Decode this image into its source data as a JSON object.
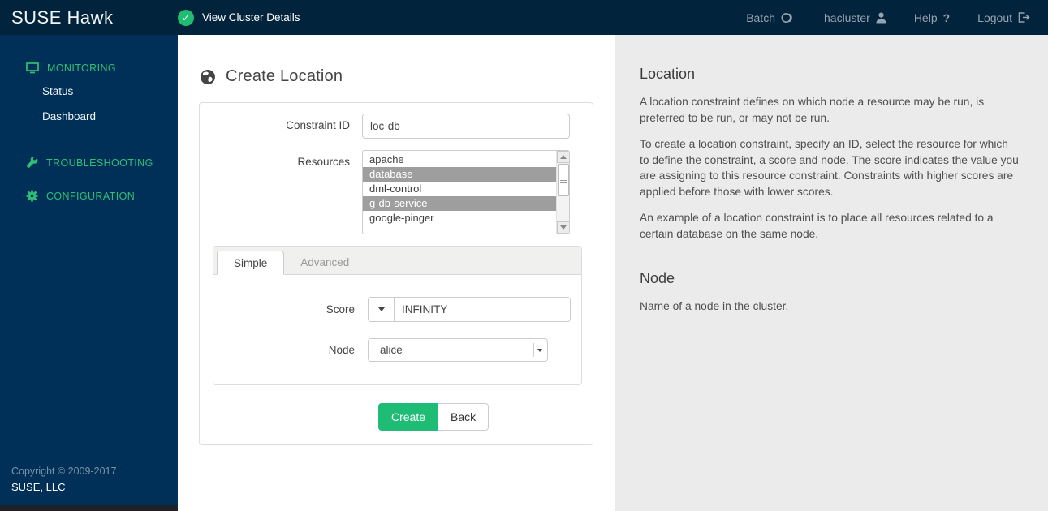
{
  "header": {
    "brand": "SUSE Hawk",
    "status_label": "View Cluster Details",
    "nav": {
      "batch": "Batch",
      "user": "hacluster",
      "help": "Help",
      "help_mark": "?",
      "logout": "Logout"
    }
  },
  "sidebar": {
    "monitoring": "MONITORING",
    "status": "Status",
    "dashboard": "Dashboard",
    "troubleshooting": "TROUBLESHOOTING",
    "configuration": "CONFIGURATION",
    "copyright": "Copyright © 2009-2017",
    "company": "SUSE, LLC"
  },
  "main": {
    "title": "Create Location",
    "form": {
      "constraint_id_label": "Constraint ID",
      "constraint_id_value": "loc-db",
      "resources_label": "Resources",
      "resources": [
        {
          "name": "apache",
          "selected": false
        },
        {
          "name": "database",
          "selected": true
        },
        {
          "name": "dml-control",
          "selected": false
        },
        {
          "name": "g-db-service",
          "selected": true
        },
        {
          "name": "google-pinger",
          "selected": false
        }
      ],
      "tabs": [
        {
          "label": "Simple",
          "active": true
        },
        {
          "label": "Advanced",
          "active": false
        }
      ],
      "score_label": "Score",
      "score_value": "INFINITY",
      "node_label": "Node",
      "node_value": "alice",
      "create_label": "Create",
      "back_label": "Back"
    }
  },
  "help_panel": {
    "location_title": "Location",
    "location_p1": "A location constraint defines on which node a resource may be run, is preferred to be run, or may not be run.",
    "location_p2": "To create a location constraint, specify an ID, select the resource for which to define the constraint, a score and node. The score indicates the value you are assigning to this resource constraint. Constraints with higher scores are applied before those with lower scores.",
    "location_p3": "An example of a location constraint is to place all resources related to a certain database on the same node.",
    "node_title": "Node",
    "node_p1": "Name of a node in the cluster."
  },
  "colors": {
    "header_navy": "#02233c",
    "sidebar_navy": "#003057",
    "accent_green": "#1fbc75",
    "sidebar_green": "#2fbf76",
    "panel_gray": "#ebebeb",
    "selected_option_gray": "#9e9e9e"
  },
  "icons": {
    "cluster_ok": "check-circle-icon",
    "batch": "batch-toggle-icon",
    "user": "user-icon",
    "help": "question-icon",
    "logout": "logout-icon",
    "monitoring": "monitor-icon",
    "troubleshooting": "wrench-icon",
    "configuration": "gear-icon",
    "page": "globe-icon"
  }
}
